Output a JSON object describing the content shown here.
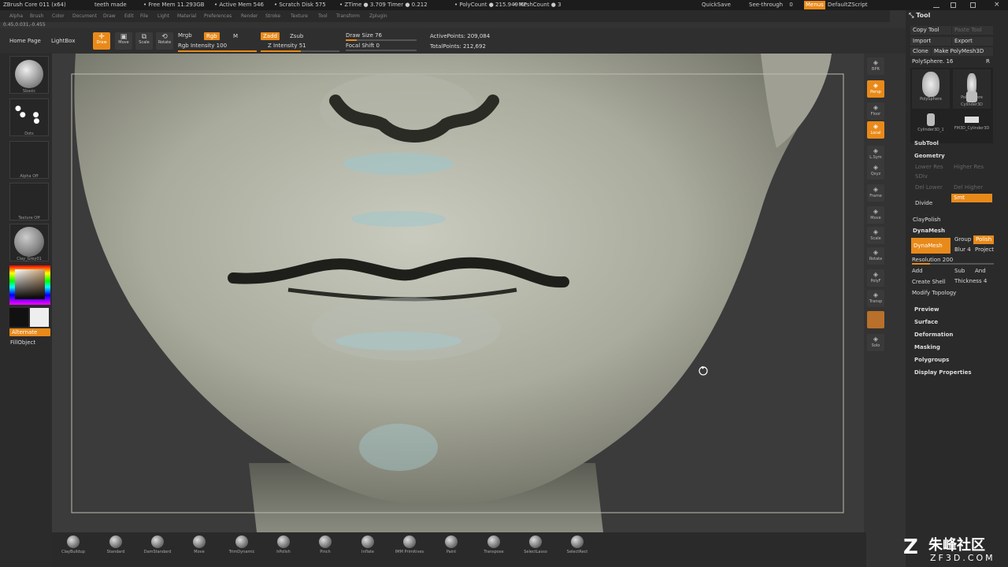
{
  "titlebar": {
    "app": "ZBrush Core 011 (x64)",
    "doc": "teeth made",
    "free_mem": "• Free Mem 11.293GB",
    "active_mem": "• Active Mem 546",
    "scratch": "• Scratch Disk 575",
    "ztime": "• ZTime ● 3.709 Timer ● 0.212",
    "polycount": "• PolyCount ● 215.949 KP",
    "meshcount": "• MeshCount ● 3",
    "quicksave": "QuickSave",
    "seethrough": "See-through",
    "seethrough_val": "0",
    "menus": "Menus",
    "script": "DefaultZScript"
  },
  "menubar": [
    "Alpha",
    "Brush",
    "Color",
    "Document",
    "Draw",
    "Edit",
    "File",
    "Light",
    "Material",
    "Preferences",
    "Render",
    "Stroke",
    "Texture",
    "Tool",
    "Transform",
    "Zplugin"
  ],
  "coords": "0.45,0.031,-0.455",
  "toolbar": {
    "home": "Home Page",
    "lightbox": "LightBox",
    "draw": "Draw",
    "move": "Move",
    "scale": "Scale",
    "rotate": "Rotate",
    "mrgb": "Mrgb",
    "rgb": "Rgb",
    "m": "M",
    "rgb_intensity": "Rgb Intensity 100",
    "zadd": "Zadd",
    "zsub": "Zsub",
    "z_intensity": "Z Intensity 51",
    "draw_size": "Draw Size 76",
    "focal_shift": "Focal Shift 0",
    "active_points": "ActivePoints: 209,084",
    "total_points": "TotalPoints: 212,692",
    "z_intensity_frac": 0.51,
    "draw_size_frac": 0.15,
    "rgb_intensity_frac": 1.0
  },
  "leftpanel": {
    "brush": "Sbasic",
    "stroke": "Dots",
    "alpha": "Alpha Off",
    "texture": "Texture Off",
    "material": "Clay_Grey01",
    "alternate": "Alternate",
    "fill": "FillObject"
  },
  "rightstrip": [
    "BPR",
    "Persp",
    "Floor",
    "Local",
    "L.Sym",
    "Qxyz",
    "Frame",
    "Move",
    "Scale",
    "Rotate",
    "PolyF",
    "Transp",
    "Solo"
  ],
  "toolpanel": {
    "title": "Tool",
    "copy_tool": "Copy Tool",
    "paste_tool": "Paste Tool",
    "import": "Import",
    "export": "Export",
    "clone": "Clone",
    "make_polymesh": "Make PolyMesh3D",
    "polysphere": "PolySphere. 16",
    "r": "R",
    "tools": [
      "PolySphere",
      "PolySphere",
      "Cylinder3D",
      "Cylinder3D_1",
      "FM3D_Cylinder3D"
    ],
    "subtool": "SubTool",
    "geometry": "Geometry",
    "lower_res": "Lower Res",
    "higher_res": "Higher Res",
    "sdiv": "SDiv",
    "del_lower": "Del Lower",
    "del_higher": "Del Higher",
    "divide": "Divide",
    "smt": "Smt",
    "claypolish": "ClayPolish",
    "dynamesh_sec": "DynaMesh",
    "dynamesh_btn": "DynaMesh",
    "group": "Group",
    "polish": "Polish",
    "blur": "Blur 4",
    "project": "Project",
    "resolution": "Resolution 200",
    "add": "Add",
    "sub": "Sub",
    "and": "And",
    "create_shell": "Create Shell",
    "thickness": "Thickness 4",
    "modify_topology": "Modify Topology",
    "sections": [
      "Preview",
      "Surface",
      "Deformation",
      "Masking",
      "Polygroups",
      "Display Properties"
    ]
  },
  "bottombar": [
    "ClayBuildup",
    "Standard",
    "DamStandard",
    "Move",
    "TrimDynamic",
    "hPolish",
    "Pinch",
    "Inflate",
    "IMM Primitives",
    "Paint",
    "Transpose",
    "SelectLasso",
    "SelectRect"
  ],
  "logo": {
    "name": "朱峰社区",
    "site": "ZF3D.COM"
  },
  "colors": {
    "accent": "#e88a1a"
  }
}
